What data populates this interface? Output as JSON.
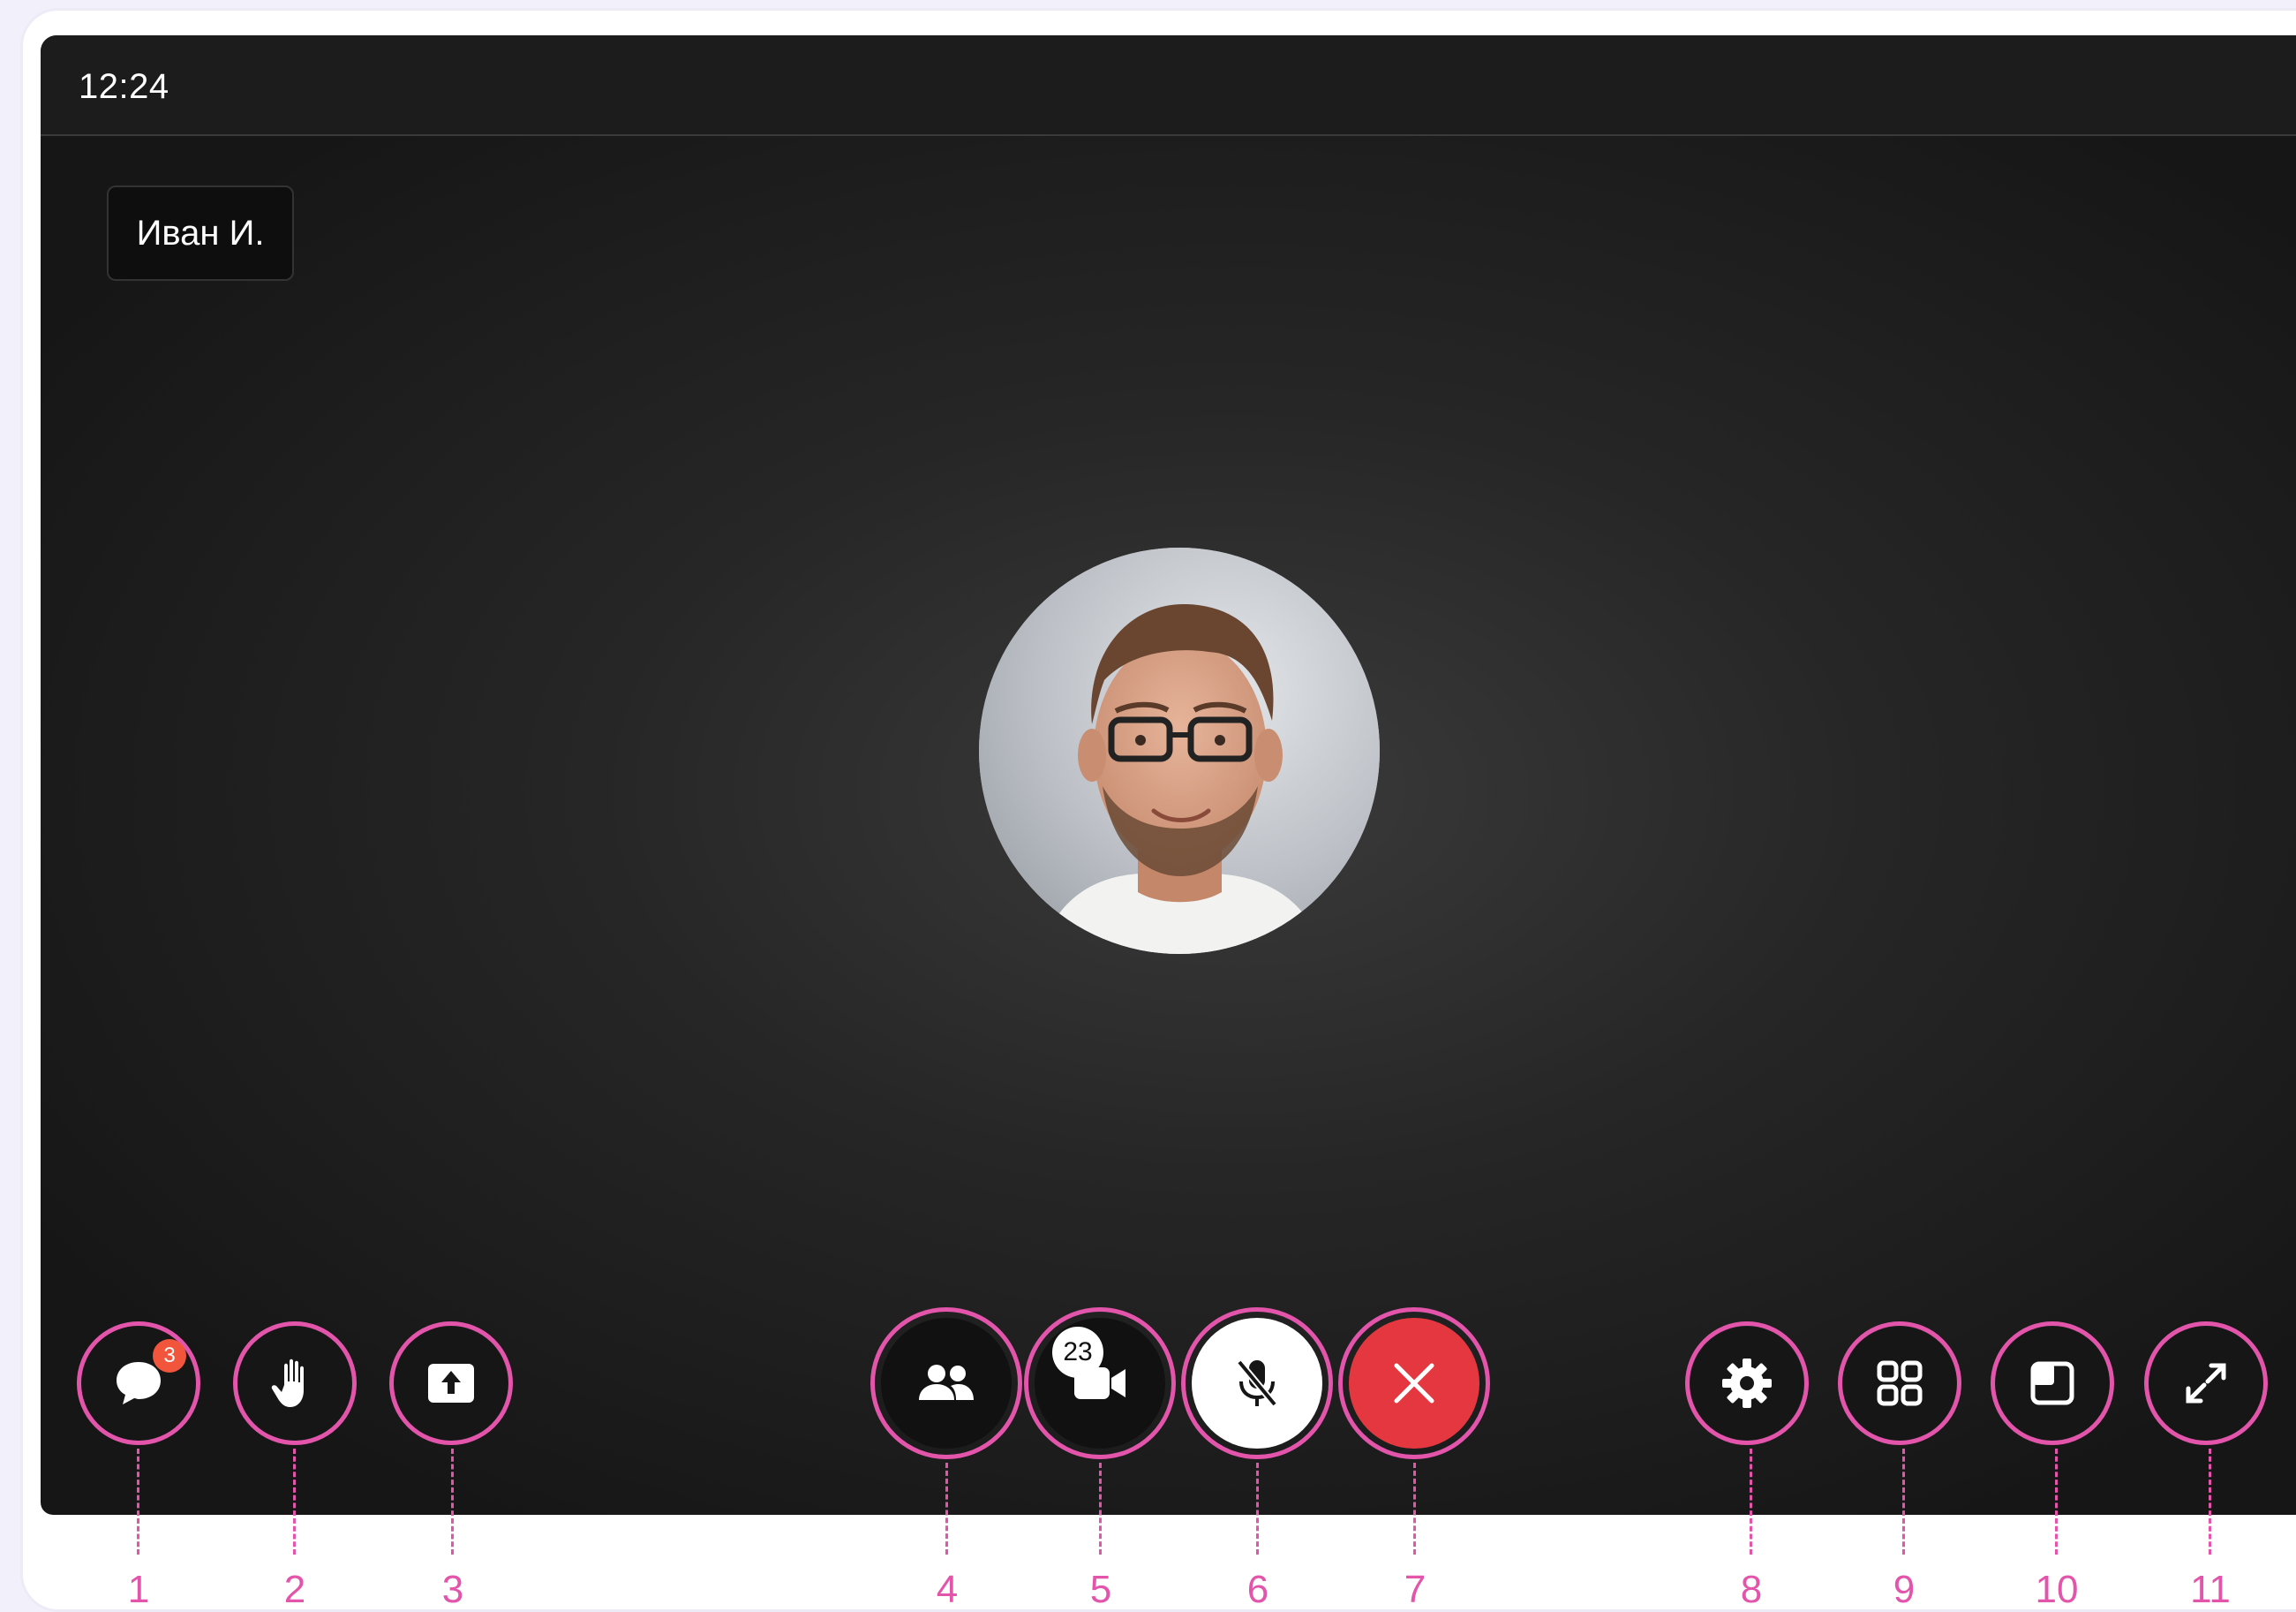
{
  "status": {
    "time": "12:24"
  },
  "participant": {
    "name": "Иван И."
  },
  "controls": {
    "chat": {
      "icon": "chat-bubble-icon",
      "unread_count": "3",
      "callout": "1"
    },
    "raise_hand": {
      "icon": "hand-icon",
      "callout": "2"
    },
    "share_screen": {
      "icon": "share-upload-icon",
      "callout": "3"
    },
    "participants": {
      "icon": "participants-icon",
      "callout": "4"
    },
    "camera": {
      "icon": "video-camera-icon",
      "participant_count": "23",
      "callout": "5"
    },
    "microphone": {
      "icon": "microphone-muted-icon",
      "callout": "6"
    },
    "end_call": {
      "icon": "close-x-icon",
      "callout": "7"
    },
    "settings": {
      "icon": "gear-icon",
      "callout": "8"
    },
    "layout_grid": {
      "icon": "grid-icon",
      "callout": "9"
    },
    "picture_in_picture": {
      "icon": "pip-window-icon",
      "callout": "10"
    },
    "fullscreen": {
      "icon": "expand-icon",
      "callout": "11"
    }
  },
  "colors": {
    "callout_accent": "#e354ab",
    "end_call": "#e5373f",
    "badge": "#f1553c",
    "call_background": "#1c1c1c"
  }
}
